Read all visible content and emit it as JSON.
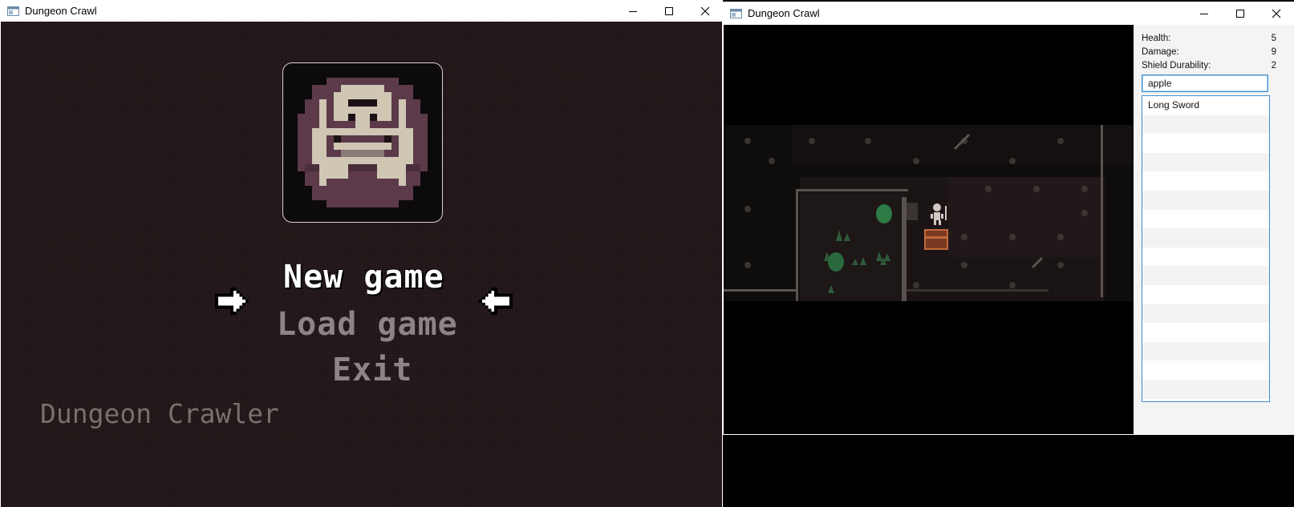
{
  "left_window": {
    "title": "Dungeon Crawl",
    "menu": {
      "new_game": "New game",
      "load_game": "Load game",
      "exit": "Exit"
    },
    "subtitle": "Dungeon Crawler",
    "selected_item": "New game"
  },
  "right_window": {
    "title": "Dungeon Crawl",
    "stats": [
      {
        "label": "Health:",
        "value": "5"
      },
      {
        "label": "Damage:",
        "value": "9"
      },
      {
        "label": "Shield Durability:",
        "value": "2"
      }
    ],
    "inventory_input": "apple",
    "inventory_items": [
      "Long Sword",
      "",
      "",
      "",
      "",
      "",
      "",
      "",
      "",
      "",
      "",
      "",
      "",
      "",
      "",
      ""
    ]
  },
  "colors": {
    "menu_bg": "#1c1516",
    "logo_purple": "#5c3a4a",
    "logo_bone": "#cfc6b4",
    "accent_blue": "#3d8fd6"
  },
  "icons": [
    "app-icon",
    "minimize-icon",
    "maximize-icon",
    "close-icon",
    "pointer-right-icon",
    "pointer-left-icon",
    "dungeon-logo-icon"
  ]
}
